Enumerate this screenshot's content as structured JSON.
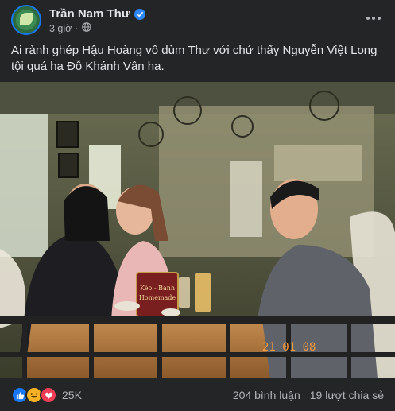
{
  "post": {
    "author": "Trần Nam Thư",
    "time": "3 giờ",
    "separator": "·",
    "caption_line1": "Ai rảnh ghép Hậu Hoàng vô dùm Thư với chứ thấy Nguyễn Việt Long",
    "caption_line2": "tội quá ha Đỗ Khánh Vân ha.",
    "photo": {
      "sign_line1": "Kéo - Bánh",
      "sign_line2": "Homemade",
      "date_stamp": "21 01 08"
    },
    "reaction_count": "25K",
    "comments": "204 bình luận",
    "shares": "19 lượt chia sẻ"
  },
  "icons": {
    "verified": "verified-badge-icon",
    "audience": "globe-icon",
    "more": "more-options-icon",
    "reactions": [
      "like-reaction-icon",
      "haha-reaction-icon",
      "love-reaction-icon"
    ]
  },
  "colors": {
    "background": "#242526",
    "text_primary": "#e4e6eb",
    "text_secondary": "#b0b3b8",
    "accent_blue": "#1877f2",
    "love_red": "#f33e58",
    "haha_yellow": "#f7b125"
  }
}
